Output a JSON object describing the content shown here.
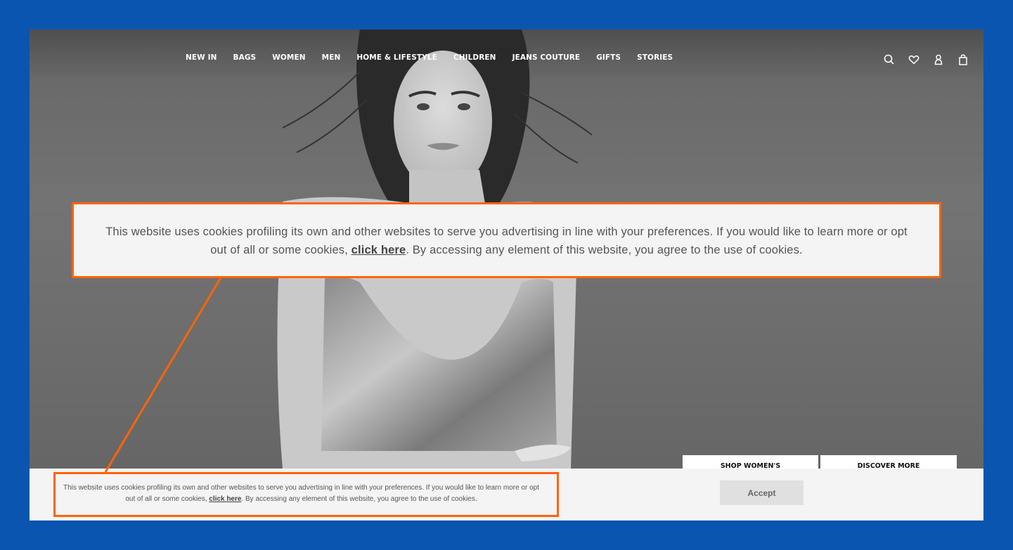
{
  "frame": {
    "background_color": "#0a55b0",
    "annotation_color": "#ff6408"
  },
  "nav": {
    "items": [
      {
        "label": "NEW IN"
      },
      {
        "label": "BAGS"
      },
      {
        "label": "WOMEN"
      },
      {
        "label": "MEN"
      },
      {
        "label": "HOME & LIFESTYLE"
      },
      {
        "label": "CHILDREN"
      },
      {
        "label": "JEANS COUTURE"
      },
      {
        "label": "GIFTS"
      },
      {
        "label": "STORIES"
      }
    ],
    "icons": [
      "search-icon",
      "heart-icon",
      "account-icon",
      "bag-icon"
    ]
  },
  "hero": {
    "cta_buttons": [
      {
        "label": "SHOP WOMEN'S"
      },
      {
        "label": "DISCOVER MORE"
      }
    ]
  },
  "cookie": {
    "text_before_link": "This website uses cookies profiling its own and other websites to serve you advertising in line with your preferences. If you would like to learn more or opt out of all or some cookies, ",
    "link_label": "click here",
    "text_after_link": ". By accessing any element of this website, you agree to the use of cookies.",
    "accept_label": "Accept"
  },
  "callout": {
    "text_before_link": "This website uses cookies profiling its own and other websites to serve you advertising in line with your preferences. If you would like to learn more or opt out of all or some cookies, ",
    "link_label": "click here",
    "text_after_link": ". By accessing any element of this website, you agree to the use of cookies."
  }
}
